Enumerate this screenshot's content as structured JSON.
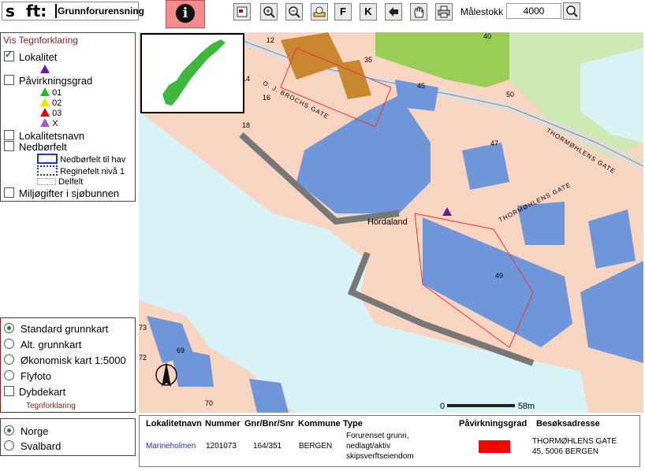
{
  "header": {
    "logo_s": "s",
    "logo_ft": "ft:",
    "app_title": "Grunnforurensning",
    "info_label": "i",
    "tools": [
      {
        "name": "full-extent-icon"
      },
      {
        "name": "zoom-in-icon"
      },
      {
        "name": "zoom-out-icon"
      },
      {
        "name": "identify-icon"
      },
      {
        "name": "f-tool",
        "label": "F"
      },
      {
        "name": "k-tool",
        "label": "K"
      },
      {
        "name": "back-arrow-icon"
      },
      {
        "name": "pan-hand-icon"
      },
      {
        "name": "print-icon"
      }
    ],
    "scale_label": "Målestokk 1:",
    "scale_value": "4000"
  },
  "legend": {
    "title": "Vis Tegnforklaring",
    "lokalitet": "Lokalitet",
    "pavirkningsgrad": "Påvirkningsgrad",
    "grades": [
      {
        "label": "01",
        "color": "#22bb22"
      },
      {
        "label": "02",
        "color": "#ffff00"
      },
      {
        "label": "03",
        "color": "#ff0000"
      },
      {
        "label": "X",
        "color": "#aa55cc"
      }
    ],
    "lokalitetsnavn": "Lokalitetsnavn",
    "nedborfelt": "Nedbørfelt",
    "nedborfelt_items": [
      "Nedbørfelt til hav",
      "Reginefelt nivå 1",
      "Delfelt"
    ],
    "miljogifter": "Miljøgifter i sjøbunnen"
  },
  "maptypes": {
    "options": [
      "Standard grunnkart",
      "Alt. grunnkart",
      "Økonomisk kart 1:5000",
      "Flyfoto"
    ],
    "dybdekart": "Dybdekart",
    "tegnforklaring_link": "Tegnforklaring"
  },
  "region": {
    "options": [
      "Norge",
      "Svalbard"
    ]
  },
  "map": {
    "place_label": "Hordaland",
    "street_labels": [
      "O. J. BROCHS GATE",
      "THORMØHLENS GATE",
      "THORMØHLENS GATE"
    ],
    "house_numbers": [
      "12",
      "35",
      "14",
      "16",
      "45",
      "18",
      "40",
      "50",
      "47",
      "49",
      "73",
      "69",
      "72",
      "70"
    ],
    "scale_start": "0",
    "scale_end": "58m"
  },
  "info": {
    "headers": [
      "Lokalitetnavn",
      "Nummer",
      "Gnr/Bnr/Snr",
      "Kommune",
      "Type",
      "Påvirkningsgrad",
      "Besøksadresse"
    ],
    "row": {
      "name": "Marineholmen",
      "nummer": "1201073",
      "gnr": "164/351",
      "kommune": "BERGEN",
      "type_lines": [
        "Forurenset grunn,",
        "nedlagt/aktiv",
        "skipsverftseiendom"
      ],
      "grade": "03",
      "address_lines": [
        "THORMØHLENS GATE",
        "45, 5006 BERGEN"
      ]
    }
  },
  "colors": {
    "water": "#d7f3f6",
    "land": "#f7d5c0",
    "building": "#6f96d8",
    "park": "#9acd55",
    "red_grade": "#ff0000",
    "accent_dark_red": "#8b1a1a"
  }
}
